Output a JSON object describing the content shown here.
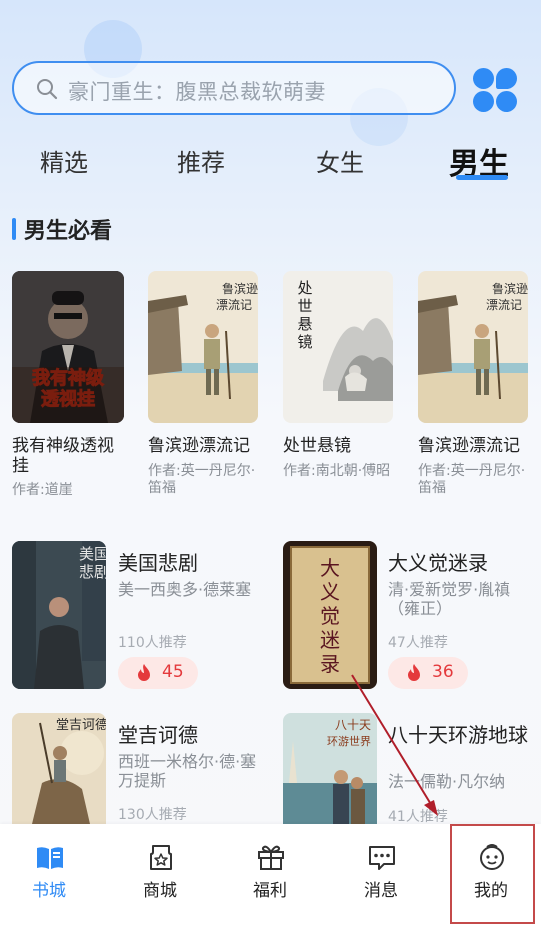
{
  "search": {
    "placeholder": "豪门重生：腹黑总裁软萌妻"
  },
  "tabs": [
    {
      "label": "精选",
      "active": false
    },
    {
      "label": "推荐",
      "active": false
    },
    {
      "label": "女生",
      "active": false
    },
    {
      "label": "男生",
      "active": true
    }
  ],
  "section": {
    "title": "男生必看"
  },
  "top_books": [
    {
      "title": "我有神级透视挂",
      "author": "作者:道崖",
      "cover_text": "我有神级透视挂"
    },
    {
      "title": "鲁滨逊漂流记",
      "author": "作者:英一丹尼尔·笛福",
      "cover_text": "鲁滨逊漂流记"
    },
    {
      "title": "处世悬镜",
      "author": "作者:南北朝·傅昭",
      "cover_text": "处世悬镜"
    },
    {
      "title": "鲁滨逊漂流记",
      "author": "作者:英一丹尼尔·笛福",
      "cover_text": "鲁滨逊漂流记"
    }
  ],
  "list_books": [
    {
      "title": "美国悲剧",
      "author": "美一西奥多·德莱塞",
      "recommend": "110人推荐",
      "heat": "45",
      "cover_text": "美国悲剧"
    },
    {
      "title": "大义觉迷录",
      "author": "清·爱新觉罗·胤禛（雍正）",
      "recommend": "47人推荐",
      "heat": "36",
      "cover_text": "大义觉迷录"
    },
    {
      "title": "堂吉诃德",
      "author": "西班一米格尔·德·塞万提斯",
      "recommend": "130人推荐",
      "cover_text": "堂吉诃德"
    },
    {
      "title": "八十天环游地球",
      "author": "法一儒勒·凡尔纳",
      "recommend": "41人推荐",
      "cover_text": "八十天环游世界"
    }
  ],
  "nav": [
    {
      "label": "书城",
      "icon": "book-icon",
      "active": true
    },
    {
      "label": "商城",
      "icon": "shop-bag-icon",
      "active": false
    },
    {
      "label": "福利",
      "icon": "gift-icon",
      "active": false
    },
    {
      "label": "消息",
      "icon": "message-icon",
      "active": false
    },
    {
      "label": "我的",
      "icon": "profile-icon",
      "active": false
    }
  ],
  "colors": {
    "accent": "#2f8bf5",
    "heat": "#e4393c",
    "annotation": "#c44a4a"
  }
}
